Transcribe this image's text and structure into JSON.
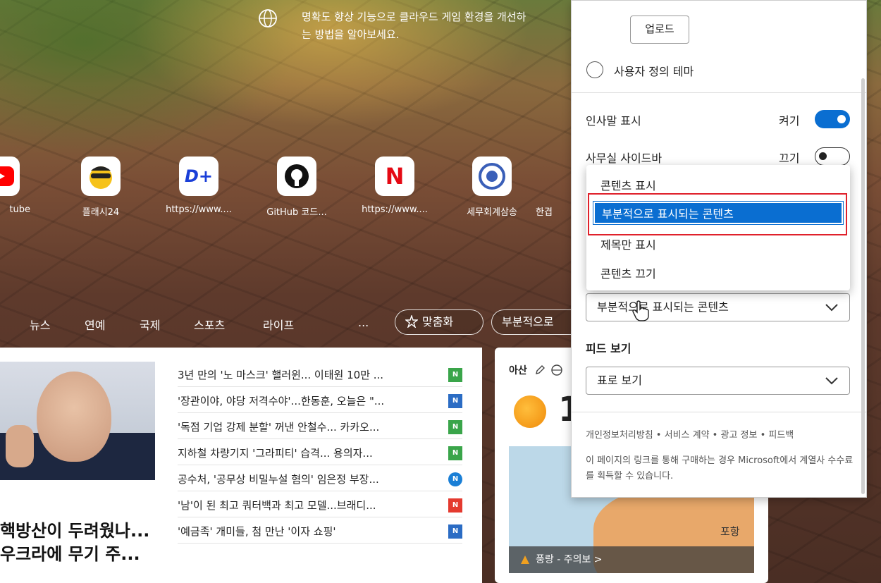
{
  "promo": {
    "text": "명확도 향상 기능으로 클라우드 게임 환경을 개선하는 방법을 알아보세요."
  },
  "quick_links": [
    {
      "label": "tube",
      "icon": "youtube-icon"
    },
    {
      "label": "플래시24",
      "icon": "flash24-icon"
    },
    {
      "label": "https://www....",
      "icon": "disney-plus-icon"
    },
    {
      "label": "GitHub 코드...",
      "icon": "github-icon"
    },
    {
      "label": "https://www....",
      "icon": "netflix-icon"
    },
    {
      "label": "세무회계삼송",
      "icon": "tax-office-icon"
    },
    {
      "label": "한겹",
      "icon": "site-icon"
    }
  ],
  "categories": [
    "뉴스",
    "연예",
    "국제",
    "스포츠",
    "라이프",
    "..."
  ],
  "personalize_label": "맞춤화",
  "layout_pill": "부분적으로",
  "feature": {
    "headline_1": "핵방산이 두려웠나...",
    "headline_2": "우크라에 무기 주..."
  },
  "news": [
    {
      "title": "3년 만의 '노 마스크' 핼러윈... 이태원 10만 ...",
      "color": "#3aa54a"
    },
    {
      "title": "'장관이야, 야당 저격수야'...한동훈, 오늘은 \"...",
      "color": "#2b6cc4"
    },
    {
      "title": "'독점 기업 강제 분할' 꺼낸 안철수... 카카오...",
      "color": "#3aa54a"
    },
    {
      "title": "지하철 차량기지 '그라피티' 습격... 용의자...",
      "color": "#3aa54a"
    },
    {
      "title": "공수처, '공무상 비밀누설 혐의' 임은정 부장...",
      "color": "#1a7fd6"
    },
    {
      "title": "'남'이 된 최고 쿼터백과 최고 모델...브래디...",
      "color": "#e43a2f"
    },
    {
      "title": "'예금족' 개미들, 첨 만난 '이자 쇼핑'",
      "color": "#2b6cc4"
    }
  ],
  "weather": {
    "location": "아산",
    "temp": "1",
    "map_label": "포항",
    "alert": "풍랑 - 주의보 >"
  },
  "panel": {
    "upload_label": "업로드",
    "custom_theme_label": "사용자 정의 테마",
    "greeting_label": "인사말 표시",
    "greeting_state": "켜기",
    "office_sidebar_label": "사무실 사이드바",
    "office_sidebar_state": "끄기",
    "content_select_value": "부분적으로 표시되는 콘텐츠",
    "feed_view_label": "피드 보기",
    "feed_view_value": "표로 보기",
    "footer_links": "개인정보처리방침 • 서비스 계약 • 광고 정보 • 피드백",
    "footer_note": "이 페이지의 링크를 통해 구매하는 경우 Microsoft에서 계열사 수수료를 획득할 수 있습니다."
  },
  "dropdown": {
    "options": [
      "콘텐츠 표시",
      "부분적으로 표시되는 콘텐츠",
      "제목만 표시",
      "콘텐츠 끄기"
    ],
    "selected_index": 1
  },
  "colors": {
    "accent": "#0a6ed1",
    "highlight_box": "#e0212b"
  }
}
